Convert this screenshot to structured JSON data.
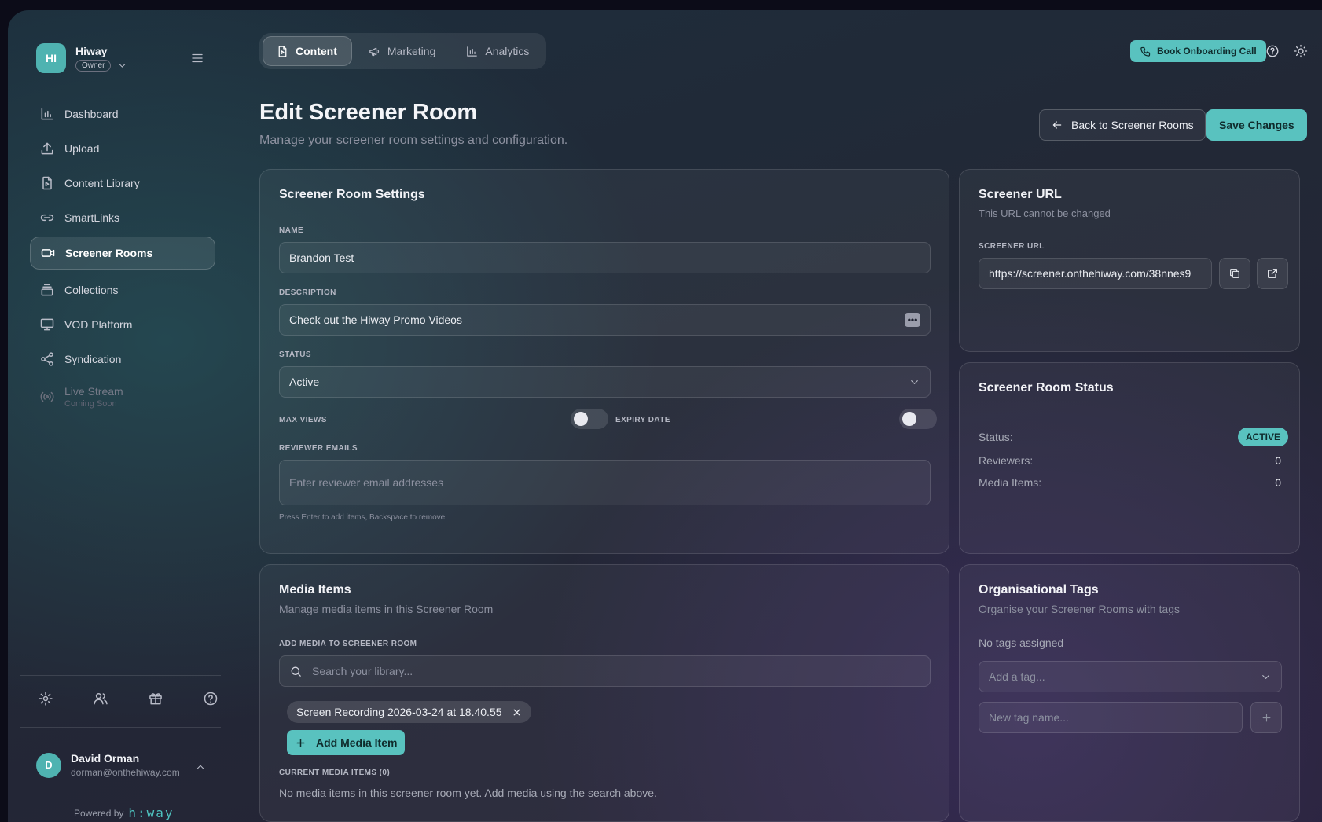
{
  "workspace": {
    "initials": "HI",
    "name": "Hiway",
    "role": "Owner"
  },
  "sidebar": {
    "items": [
      {
        "label": "Dashboard",
        "icon": "chart-icon"
      },
      {
        "label": "Upload",
        "icon": "upload-icon"
      },
      {
        "label": "Content Library",
        "icon": "file-icon"
      },
      {
        "label": "SmartLinks",
        "icon": "link-icon"
      },
      {
        "label": "Screener Rooms",
        "icon": "video-icon",
        "active": true
      },
      {
        "label": "Collections",
        "icon": "layers-icon"
      },
      {
        "label": "VOD Platform",
        "icon": "monitor-icon"
      },
      {
        "label": "Syndication",
        "icon": "share-icon"
      },
      {
        "label": "Live Stream",
        "sublabel": "Coming Soon",
        "icon": "broadcast-icon"
      }
    ]
  },
  "user": {
    "initial": "D",
    "name": "David Orman",
    "email": "dorman@onthehiway.com"
  },
  "powered": {
    "label": "Powered by",
    "logo": "h:way"
  },
  "tabs": [
    {
      "label": "Content",
      "active": true
    },
    {
      "label": "Marketing"
    },
    {
      "label": "Analytics"
    }
  ],
  "topbar": {
    "book_label": "Book Onboarding Call"
  },
  "header": {
    "title": "Edit Screener Room",
    "subtitle": "Manage your screener room settings and configuration.",
    "back_label": "Back to Screener Rooms",
    "save_label": "Save Changes"
  },
  "settings": {
    "title": "Screener Room Settings",
    "name_label": "NAME",
    "name_value": "Brandon Test",
    "description_label": "DESCRIPTION",
    "description_value": "Check out the Hiway Promo Videos",
    "status_label": "STATUS",
    "status_value": "Active",
    "max_views_label": "MAX VIEWS",
    "expiry_label": "EXPIRY DATE",
    "reviewers_label": "REVIEWER EMAILS",
    "reviewers_placeholder": "Enter reviewer email addresses",
    "reviewers_hint": "Press Enter to add items, Backspace to remove"
  },
  "url_card": {
    "title": "Screener URL",
    "subtitle": "This URL cannot be changed",
    "label": "SCREENER URL",
    "value": "https://screener.onthehiway.com/38nnes9"
  },
  "status_card": {
    "title": "Screener Room Status",
    "status_label": "Status:",
    "status_value": "ACTIVE",
    "reviewers_label": "Reviewers:",
    "reviewers_value": "0",
    "media_label": "Media Items:",
    "media_value": "0"
  },
  "media": {
    "title": "Media Items",
    "subtitle": "Manage media items in this Screener Room",
    "add_label": "ADD MEDIA TO SCREENER ROOM",
    "search_placeholder": "Search your library...",
    "chip": "Screen Recording 2026-03-24 at 18.40.55",
    "add_button": "Add Media Item",
    "current_label": "CURRENT MEDIA ITEMS (0)",
    "empty": "No media items in this screener room yet. Add media using the search above."
  },
  "tags": {
    "title": "Organisational Tags",
    "subtitle": "Organise your Screener Rooms with tags",
    "none": "No tags assigned",
    "select_placeholder": "Add a tag...",
    "new_placeholder": "New tag name..."
  },
  "colors": {
    "accent": "#59c2bf"
  }
}
